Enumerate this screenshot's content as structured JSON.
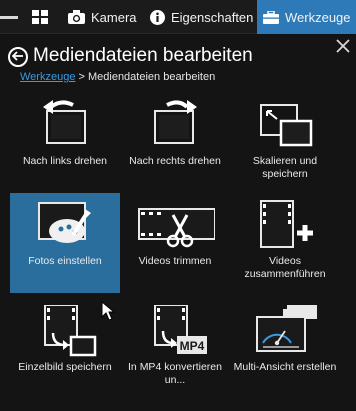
{
  "toolbar": {
    "grid_icon": "grid-icon",
    "kamera": "Kamera",
    "eigenschaften": "Eigenschaften",
    "werkzeuge": "Werkzeuge"
  },
  "panel": {
    "title": "Mediendateien bearbeiten",
    "breadcrumb": {
      "link": "Werkzeuge",
      "sep": " > ",
      "current": "Mediendateien bearbeiten"
    }
  },
  "tools": [
    {
      "id": "rotate-left",
      "label": "Nach links drehen"
    },
    {
      "id": "rotate-right",
      "label": "Nach rechts drehen"
    },
    {
      "id": "scale",
      "label": "Skalieren und speichern"
    },
    {
      "id": "adjust",
      "label": "Fotos einstellen",
      "selected": true
    },
    {
      "id": "trim",
      "label": "Videos trimmen"
    },
    {
      "id": "merge",
      "label": "Videos zusammenführen"
    },
    {
      "id": "frame",
      "label": "Einzelbild speichern"
    },
    {
      "id": "mp4",
      "label": "In MP4 konvertieren un...",
      "badge": "MP4"
    },
    {
      "id": "multi",
      "label": "Multi-Ansicht erstellen"
    }
  ],
  "colors": {
    "accent": "#2e7ab8",
    "selected": "#2a6e9e",
    "link": "#3a9be0"
  }
}
